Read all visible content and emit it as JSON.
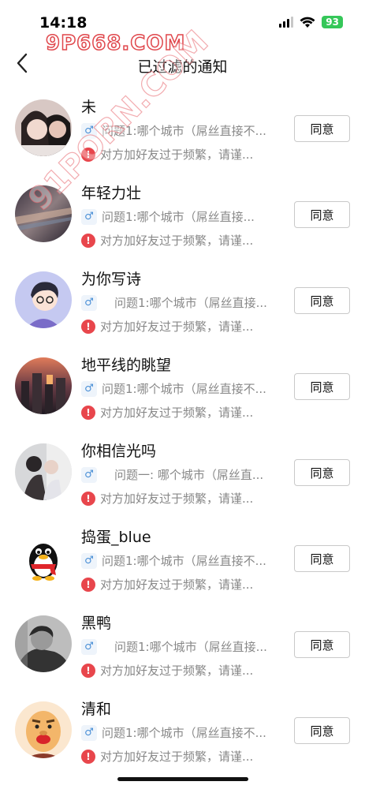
{
  "status_bar": {
    "time": "14:18",
    "battery": "93"
  },
  "watermark": {
    "top": "9P668.COM",
    "diagonal": "91PORN.COM"
  },
  "nav": {
    "title": "已过滤的通知"
  },
  "gender_glyph": "♂",
  "warn_glyph": "!",
  "agree_label": "同意",
  "rows": [
    {
      "name": "未",
      "question": "问题1:哪个城市（屌丝直接不...",
      "warning": "对方加好友过于频繁，请谨...",
      "avatar": "photo-girls",
      "indent": false
    },
    {
      "name": "年轻力壮",
      "question": "问题1:哪个城市（屌丝直接...",
      "warning": "对方加好友过于频繁，请谨...",
      "avatar": "photo-abstract",
      "indent": false
    },
    {
      "name": "为你写诗",
      "question": "问题1:哪个城市（屌丝直接...",
      "warning": "对方加好友过于频繁，请谨...",
      "avatar": "illustration-boy",
      "indent": true
    },
    {
      "name": "地平线的眺望",
      "question": "问题1:哪个城市（屌丝直接不...",
      "warning": "对方加好友过于频繁，请谨...",
      "avatar": "photo-city",
      "indent": false
    },
    {
      "name": "你相信光吗",
      "question": "问题一: 哪个城市（屌丝直...",
      "warning": "对方加好友过于频繁，请谨...",
      "avatar": "photo-couple",
      "indent": true
    },
    {
      "name": "捣蛋_blue",
      "question": "问题1:哪个城市（屌丝直接不...",
      "warning": "对方加好友过于频繁，请谨...",
      "avatar": "qq-penguin",
      "indent": false
    },
    {
      "name": "黑鸭",
      "question": "问题1:哪个城市（屌丝直接...",
      "warning": "对方加好友过于频繁，请谨...",
      "avatar": "photo-man",
      "indent": true
    },
    {
      "name": "清和",
      "question": "问题1:哪个城市（屌丝直接不...",
      "warning": "对方加好友过于频繁，请谨...",
      "avatar": "cartoon-monk",
      "indent": false
    }
  ]
}
